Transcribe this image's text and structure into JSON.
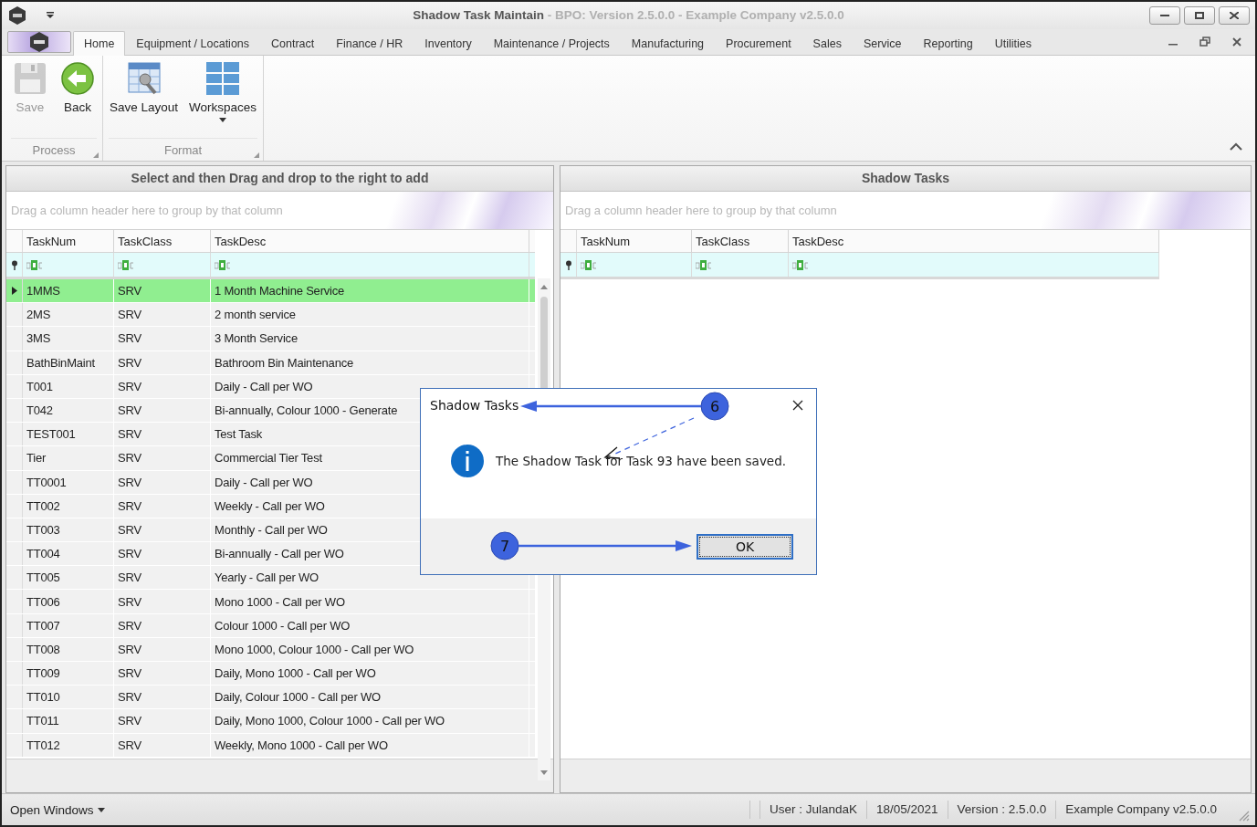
{
  "window": {
    "title": "Shadow Task Maintain",
    "subtitle": "- BPO: Version 2.5.0.0 - Example Company v2.5.0.0"
  },
  "ribbon_tabs": [
    {
      "label": "Home",
      "selected": true
    },
    {
      "label": "Equipment / Locations",
      "selected": false
    },
    {
      "label": "Contract",
      "selected": false
    },
    {
      "label": "Finance / HR",
      "selected": false
    },
    {
      "label": "Inventory",
      "selected": false
    },
    {
      "label": "Maintenance / Projects",
      "selected": false
    },
    {
      "label": "Manufacturing",
      "selected": false
    },
    {
      "label": "Procurement",
      "selected": false
    },
    {
      "label": "Sales",
      "selected": false
    },
    {
      "label": "Service",
      "selected": false
    },
    {
      "label": "Reporting",
      "selected": false
    },
    {
      "label": "Utilities",
      "selected": false
    }
  ],
  "ribbon_groups": [
    {
      "label": "Process",
      "buttons": [
        {
          "label": "Save",
          "disabled": true,
          "dropdown": false
        },
        {
          "label": "Back",
          "disabled": false,
          "dropdown": false
        }
      ]
    },
    {
      "label": "Format",
      "buttons": [
        {
          "label": "Save Layout",
          "disabled": false,
          "dropdown": false
        },
        {
          "label": "Workspaces",
          "disabled": false,
          "dropdown": true
        }
      ]
    }
  ],
  "left_grid": {
    "title": "Select and then Drag and drop to the right to add",
    "group_hint": "Drag a column header here to group by that column",
    "columns": [
      "TaskNum",
      "TaskClass",
      "TaskDesc"
    ],
    "rows": [
      {
        "cells": [
          "1MMS",
          "SRV",
          "1 Month Machine Service"
        ],
        "selected": true
      },
      {
        "cells": [
          "2MS",
          "SRV",
          "2 month service"
        ],
        "selected": false
      },
      {
        "cells": [
          "3MS",
          "SRV",
          "3 Month Service"
        ],
        "selected": false
      },
      {
        "cells": [
          "BathBinMaint",
          "SRV",
          "Bathroom Bin Maintenance"
        ],
        "selected": false
      },
      {
        "cells": [
          "T001",
          "SRV",
          "Daily - Call per WO"
        ],
        "selected": false
      },
      {
        "cells": [
          "T042",
          "SRV",
          "Bi-annually, Colour 1000 - Generate"
        ],
        "selected": false
      },
      {
        "cells": [
          "TEST001",
          "SRV",
          "Test Task"
        ],
        "selected": false
      },
      {
        "cells": [
          "Tier",
          "SRV",
          "Commercial Tier Test"
        ],
        "selected": false
      },
      {
        "cells": [
          "TT0001",
          "SRV",
          "Daily - Call per WO"
        ],
        "selected": false
      },
      {
        "cells": [
          "TT002",
          "SRV",
          "Weekly - Call per WO"
        ],
        "selected": false
      },
      {
        "cells": [
          "TT003",
          "SRV",
          " Monthly - Call per WO"
        ],
        "selected": false
      },
      {
        "cells": [
          "TT004",
          "SRV",
          "Bi-annually - Call per WO"
        ],
        "selected": false
      },
      {
        "cells": [
          "TT005",
          "SRV",
          "Yearly - Call per WO"
        ],
        "selected": false
      },
      {
        "cells": [
          "TT006",
          "SRV",
          "Mono 1000 - Call per WO"
        ],
        "selected": false
      },
      {
        "cells": [
          "TT007",
          "SRV",
          "Colour 1000 - Call per WO"
        ],
        "selected": false
      },
      {
        "cells": [
          "TT008",
          "SRV",
          "Mono 1000, Colour 1000 - Call per WO"
        ],
        "selected": false
      },
      {
        "cells": [
          "TT009",
          "SRV",
          "Daily, Mono 1000 - Call per WO"
        ],
        "selected": false
      },
      {
        "cells": [
          "TT010",
          "SRV",
          "Daily, Colour 1000 - Call per WO"
        ],
        "selected": false
      },
      {
        "cells": [
          "TT011",
          "SRV",
          "Daily, Mono 1000, Colour 1000 - Call per WO"
        ],
        "selected": false
      },
      {
        "cells": [
          "TT012",
          "SRV",
          "Weekly, Mono 1000 - Call per WO"
        ],
        "selected": false
      }
    ]
  },
  "right_grid": {
    "title": "Shadow Tasks",
    "group_hint": "Drag a column header here to group by that column",
    "columns": [
      "TaskNum",
      "TaskClass",
      "TaskDesc"
    ]
  },
  "dialog": {
    "title": "Shadow Tasks",
    "message": "The Shadow Task for Task 93 have been saved.",
    "button": "OK"
  },
  "annotations": [
    {
      "number": "6"
    },
    {
      "number": "7"
    }
  ],
  "status_bar": {
    "open_windows": "Open Windows",
    "fields": [
      "User : JulandaK",
      "18/05/2021",
      "Version : 2.5.0.0",
      "Example Company v2.5.0.0"
    ]
  }
}
